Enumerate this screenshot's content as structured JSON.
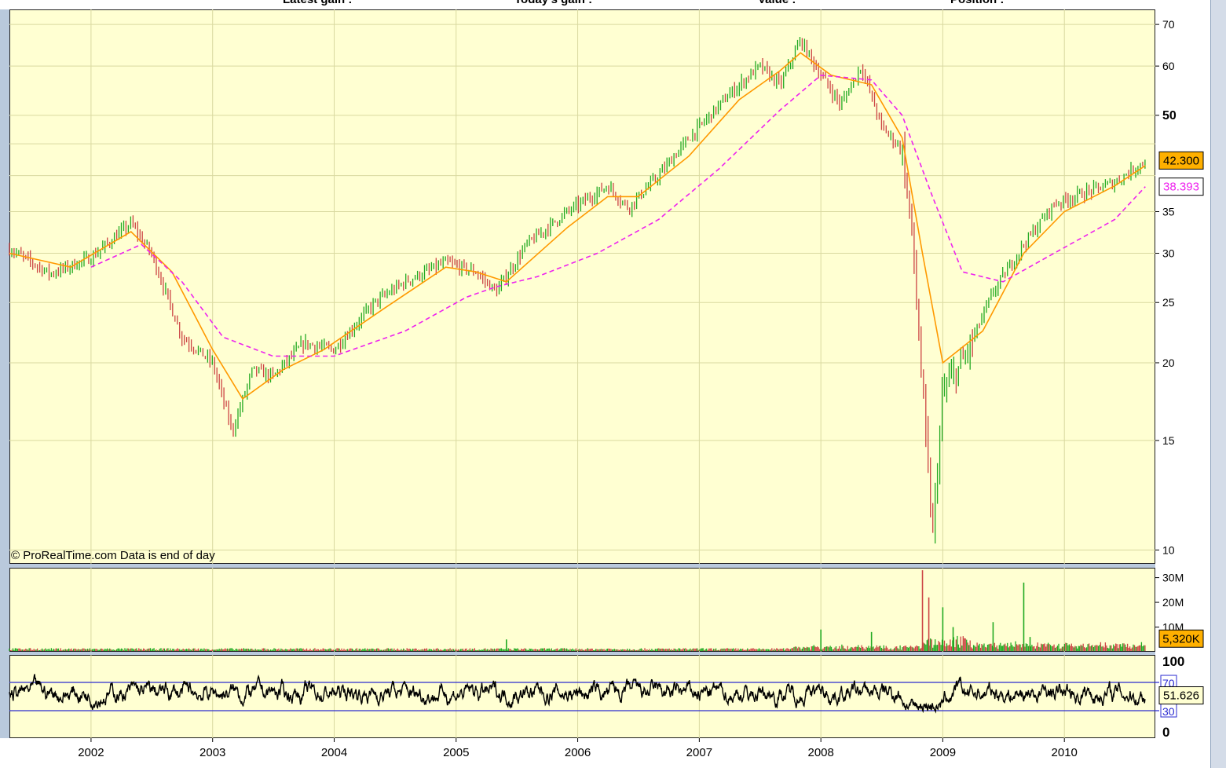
{
  "header": {
    "labels": [
      "Latest gain :",
      "Today's gain :",
      "Value :",
      "Position :"
    ]
  },
  "copyright": "© ProRealTime.com  Data is end of day",
  "colors": {
    "background": "#ffffd2",
    "up_bar": "#22aa22",
    "down_bar": "#cc4444",
    "ma_fast": "#ff9900",
    "ma_slow": "#ee22ee",
    "rsi_line": "#000000",
    "rsi_bands": "#2a2ad0",
    "price_tag": "#ffb000"
  },
  "chart_data": [
    {
      "type": "line",
      "title": "",
      "y_scale": "log",
      "ylim": [
        9.5,
        74
      ],
      "xlim": [
        "2001-05-01",
        "2010-10-01"
      ],
      "y_ticks": [
        "70",
        "60",
        "50",
        "35",
        "30",
        "25",
        "20",
        "15",
        "10"
      ],
      "x_ticks": [
        "2002",
        "2003",
        "2004",
        "2005",
        "2006",
        "2007",
        "2008",
        "2009",
        "2010"
      ],
      "grid": true,
      "series": [
        {
          "role": "price",
          "x": [
            "2001-05",
            "2001-09",
            "2002-01",
            "2002-05",
            "2002-07",
            "2002-10",
            "2003-01",
            "2003-03",
            "2003-05",
            "2003-07",
            "2003-10",
            "2004-01",
            "2004-05",
            "2004-08",
            "2004-12",
            "2005-03",
            "2005-05",
            "2005-08",
            "2005-12",
            "2006-04",
            "2006-06",
            "2006-09",
            "2006-12",
            "2007-04",
            "2007-07",
            "2007-09",
            "2007-11",
            "2008-01",
            "2008-03",
            "2008-05",
            "2008-07",
            "2008-09",
            "2008-10",
            "2008-11",
            "2008-12",
            "2009-01",
            "2009-03",
            "2009-06",
            "2009-09",
            "2009-12",
            "2010-03",
            "2010-06",
            "2010-09"
          ],
          "values": [
            30.5,
            27.8,
            29.5,
            33.5,
            30,
            22,
            20,
            15.5,
            19.5,
            19,
            21.5,
            21,
            25,
            27,
            29,
            28,
            26,
            31,
            35,
            38.5,
            35.5,
            40,
            46,
            54,
            60,
            56,
            66,
            58,
            52,
            60,
            48,
            44,
            32,
            18,
            10.5,
            18,
            20,
            26,
            31,
            36,
            37.5,
            39,
            42.3
          ]
        },
        {
          "role": "moving-average-fast",
          "x": [
            "2001-05",
            "2001-11",
            "2002-05",
            "2002-09",
            "2003-01",
            "2003-04",
            "2003-08",
            "2003-12",
            "2004-06",
            "2004-12",
            "2005-03",
            "2005-06",
            "2005-12",
            "2006-04",
            "2006-07",
            "2006-12",
            "2007-05",
            "2007-09",
            "2007-11",
            "2008-02",
            "2008-06",
            "2008-09",
            "2008-11",
            "2009-01",
            "2009-05",
            "2009-09",
            "2010-01",
            "2010-06",
            "2010-09"
          ],
          "values": [
            30,
            28.5,
            32.5,
            28,
            21,
            17.5,
            19.5,
            21,
            24.5,
            28.5,
            28,
            27,
            33,
            37,
            37,
            43,
            53,
            59,
            63,
            58,
            56,
            46,
            30,
            20,
            22.5,
            30,
            35,
            38.5,
            41.5
          ]
        },
        {
          "role": "moving-average-slow",
          "x": [
            "2002-01",
            "2002-06",
            "2002-10",
            "2003-02",
            "2003-07",
            "2004-01",
            "2004-08",
            "2005-02",
            "2005-05",
            "2005-09",
            "2006-03",
            "2006-09",
            "2007-03",
            "2007-09",
            "2008-01",
            "2008-06",
            "2008-09",
            "2008-12",
            "2009-03",
            "2009-07",
            "2009-12",
            "2010-06",
            "2010-09"
          ],
          "values": [
            28.5,
            31,
            27,
            22,
            20.5,
            20.5,
            22.5,
            25.5,
            26.5,
            27.5,
            30,
            34,
            41,
            51,
            58,
            57,
            50,
            37,
            28,
            27,
            30,
            34,
            38.393
          ]
        }
      ],
      "last_price": "42.300",
      "ma_label": "38.393"
    },
    {
      "type": "bar",
      "title": "",
      "y_ticks": [
        "30M",
        "20M",
        "10M"
      ],
      "last_volume": "5,320K",
      "ylim": [
        0,
        34
      ],
      "spikes": [
        {
          "x": "2008-11",
          "value": 33
        },
        {
          "x": "2008-11-20",
          "value": 22
        },
        {
          "x": "2009-01",
          "value": 18
        },
        {
          "x": "2009-02",
          "value": 10
        },
        {
          "x": "2009-06",
          "value": 12
        },
        {
          "x": "2009-09",
          "value": 28
        },
        {
          "x": "2009-09-20",
          "value": 6
        },
        {
          "x": "2008-01",
          "value": 9
        },
        {
          "x": "2008-06",
          "value": 8
        },
        {
          "x": "2005-06",
          "value": 5
        }
      ]
    },
    {
      "type": "line",
      "title": "",
      "y_ticks": [
        "100",
        "70",
        "30",
        "0"
      ],
      "ylim": [
        0,
        100
      ],
      "bands": [
        70,
        30
      ],
      "last_value": "51.626"
    }
  ]
}
